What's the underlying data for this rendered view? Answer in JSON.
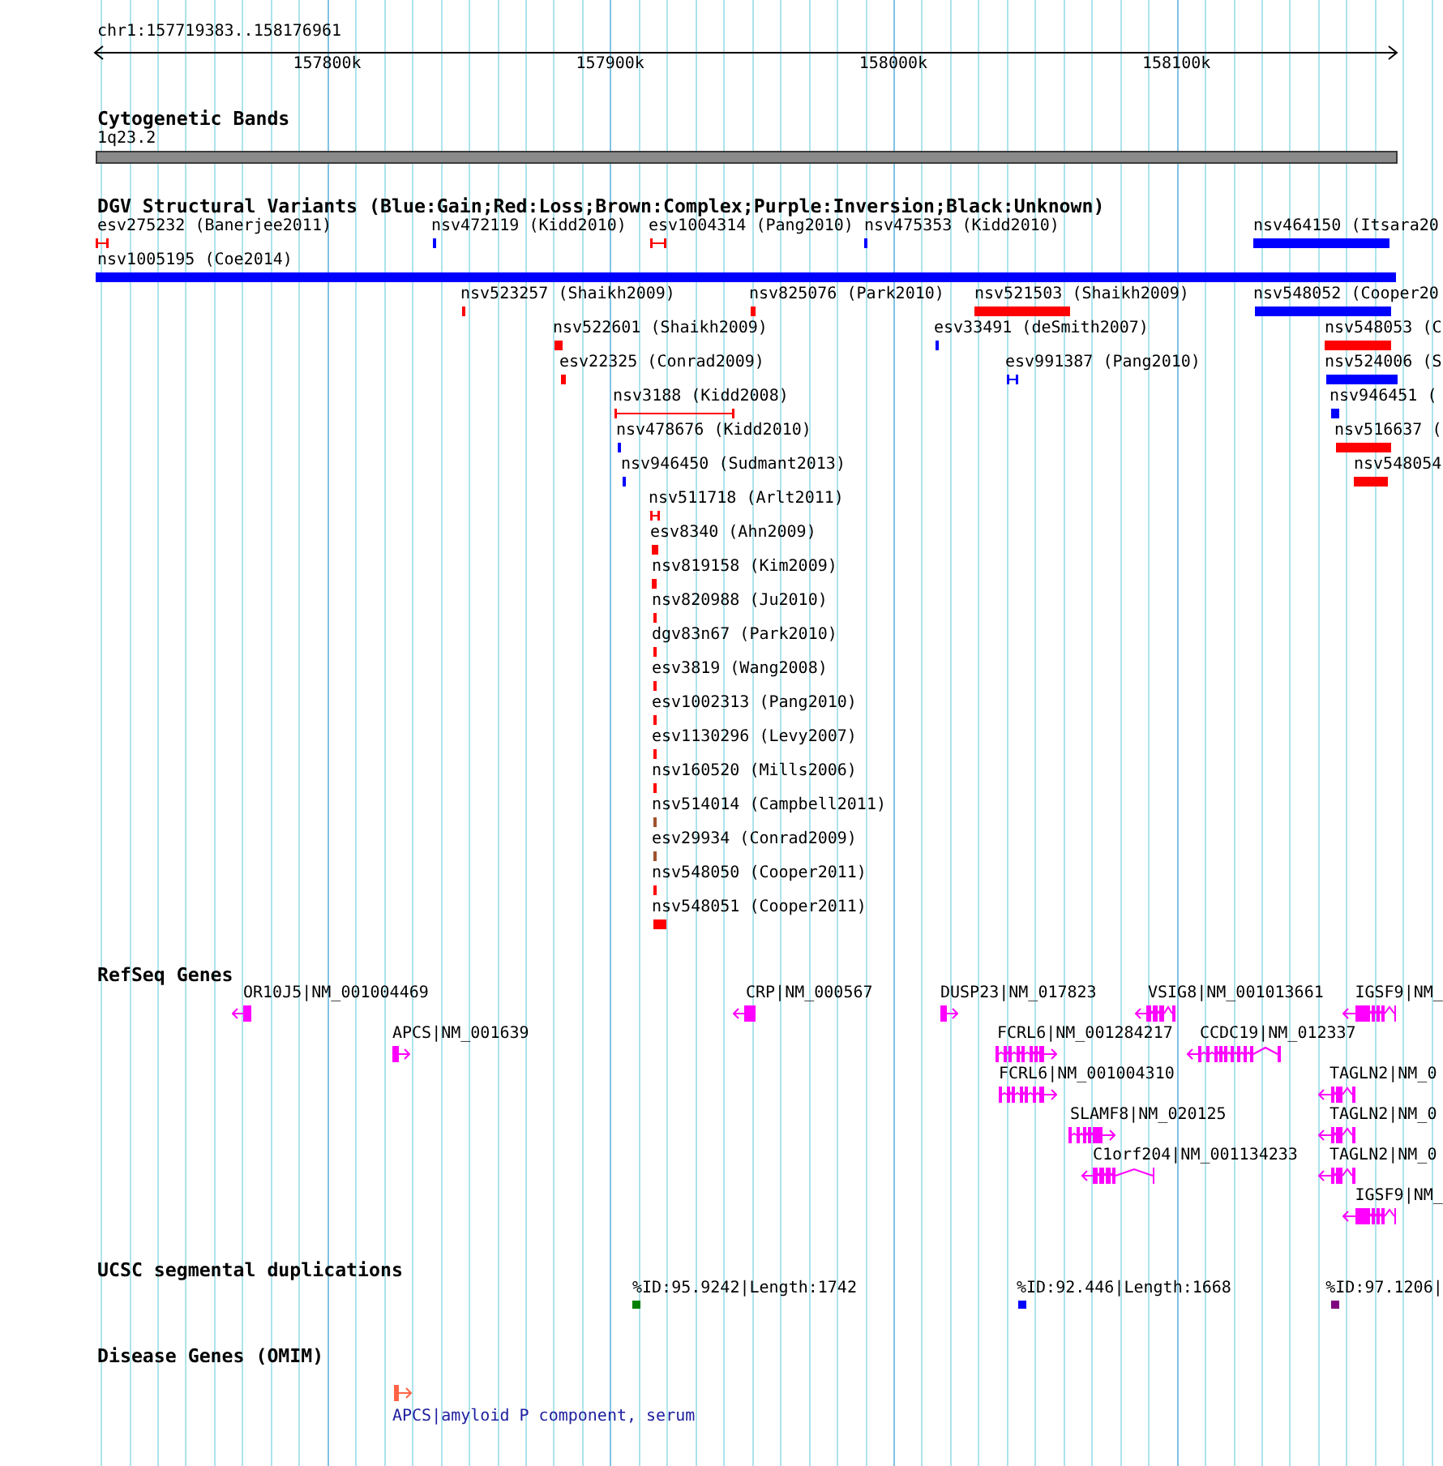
{
  "ruler": {
    "label": "chr1:157719383..158176961",
    "tick_labels": [
      "157800k",
      "157900k",
      "158000k",
      "158100k"
    ]
  },
  "cytogenetic_bands": {
    "title": "Cytogenetic Bands",
    "band": "1q23.2"
  },
  "dgv_variants": {
    "title": "DGV Structural Variants (Blue:Gain;Red:Loss;Brown:Complex;Purple:Inversion;Black:Unknown)",
    "items": [
      {
        "label": "esv275232 (Banerjee2011)",
        "color": "#ff0000",
        "kind": "span"
      },
      {
        "label": "nsv472119 (Kidd2010)",
        "color": "#0000ff",
        "kind": "bar"
      },
      {
        "label": "esv1004314 (Pang2010)",
        "color": "#ff0000",
        "kind": "span"
      },
      {
        "label": "nsv475353 (Kidd2010)",
        "color": "#0000ff",
        "kind": "bar"
      },
      {
        "label": "nsv464150 (Itsara20",
        "color": "#0000ff",
        "kind": "bar"
      },
      {
        "label": "nsv1005195 (Coe2014)",
        "color": "#0000ff",
        "kind": "bar"
      },
      {
        "label": "nsv523257 (Shaikh2009)",
        "color": "#ff0000",
        "kind": "bar"
      },
      {
        "label": "nsv825076 (Park2010)",
        "color": "#ff0000",
        "kind": "bar"
      },
      {
        "label": "nsv521503 (Shaikh2009)",
        "color": "#ff0000",
        "kind": "bar"
      },
      {
        "label": "nsv548052 (Cooper20",
        "color": "#0000ff",
        "kind": "bar"
      },
      {
        "label": "nsv522601 (Shaikh2009)",
        "color": "#ff0000",
        "kind": "bar"
      },
      {
        "label": "esv33491 (deSmith2007)",
        "color": "#0000ff",
        "kind": "bar"
      },
      {
        "label": "nsv548053 (C",
        "color": "#ff0000",
        "kind": "bar"
      },
      {
        "label": "esv22325 (Conrad2009)",
        "color": "#ff0000",
        "kind": "bar"
      },
      {
        "label": "esv991387 (Pang2010)",
        "color": "#0000ff",
        "kind": "span"
      },
      {
        "label": "nsv524006 (S",
        "color": "#0000ff",
        "kind": "bar"
      },
      {
        "label": "nsv3188 (Kidd2008)",
        "color": "#ff0000",
        "kind": "span"
      },
      {
        "label": "nsv946451 (",
        "color": "#0000ff",
        "kind": "bar"
      },
      {
        "label": "nsv478676 (Kidd2010)",
        "color": "#0000ff",
        "kind": "bar"
      },
      {
        "label": "nsv516637 (",
        "color": "#ff0000",
        "kind": "bar"
      },
      {
        "label": "nsv946450 (Sudmant2013)",
        "color": "#0000ff",
        "kind": "bar"
      },
      {
        "label": "nsv548054",
        "color": "#ff0000",
        "kind": "bar"
      },
      {
        "label": "nsv511718 (Arlt2011)",
        "color": "#ff0000",
        "kind": "span"
      },
      {
        "label": "esv8340 (Ahn2009)",
        "color": "#ff0000",
        "kind": "bar"
      },
      {
        "label": "nsv819158 (Kim2009)",
        "color": "#ff0000",
        "kind": "bar"
      },
      {
        "label": "nsv820988 (Ju2010)",
        "color": "#ff0000",
        "kind": "bar"
      },
      {
        "label": "dgv83n67 (Park2010)",
        "color": "#ff0000",
        "kind": "bar"
      },
      {
        "label": "esv3819 (Wang2008)",
        "color": "#ff0000",
        "kind": "bar"
      },
      {
        "label": "esv1002313 (Pang2010)",
        "color": "#ff0000",
        "kind": "bar"
      },
      {
        "label": "esv1130296 (Levy2007)",
        "color": "#ff0000",
        "kind": "bar"
      },
      {
        "label": "nsv160520 (Mills2006)",
        "color": "#ff0000",
        "kind": "bar"
      },
      {
        "label": "nsv514014 (Campbell2011)",
        "color": "#a0522d",
        "kind": "bar"
      },
      {
        "label": "esv29934 (Conrad2009)",
        "color": "#a0522d",
        "kind": "bar"
      },
      {
        "label": "nsv548050 (Cooper2011)",
        "color": "#ff0000",
        "kind": "bar"
      },
      {
        "label": "nsv548051 (Cooper2011)",
        "color": "#ff0000",
        "kind": "bar"
      }
    ]
  },
  "refseq_genes": {
    "title": "RefSeq Genes",
    "items": [
      {
        "label": "OR10J5|NM_001004469",
        "reverse_strand": true
      },
      {
        "label": "CRP|NM_000567",
        "reverse_strand": true
      },
      {
        "label": "DUSP23|NM_017823",
        "reverse_strand": false
      },
      {
        "label": "VSIG8|NM_001013661",
        "reverse_strand": true
      },
      {
        "label": "IGSF9|NM_",
        "reverse_strand": true
      },
      {
        "label": "APCS|NM_001639",
        "reverse_strand": false
      },
      {
        "label": "FCRL6|NM_001284217",
        "reverse_strand": false
      },
      {
        "label": "CCDC19|NM_012337",
        "reverse_strand": true
      },
      {
        "label": "FCRL6|NM_001004310",
        "reverse_strand": false
      },
      {
        "label": "TAGLN2|NM_0",
        "reverse_strand": true
      },
      {
        "label": "SLAMF8|NM_020125",
        "reverse_strand": false
      },
      {
        "label": "TAGLN2|NM_0",
        "reverse_strand": true
      },
      {
        "label": "C1orf204|NM_001134233",
        "reverse_strand": true
      },
      {
        "label": "TAGLN2|NM_0",
        "reverse_strand": true
      },
      {
        "label": "IGSF9|NM_",
        "reverse_strand": true
      }
    ]
  },
  "segmental_duplications": {
    "title": "UCSC segmental duplications",
    "items": [
      {
        "label": "%ID:95.9242|Length:1742",
        "color": "#008000"
      },
      {
        "label": "%ID:92.446|Length:1668",
        "color": "#0000ff"
      },
      {
        "label": "%ID:97.1206|",
        "color": "#800080"
      }
    ]
  },
  "disease_genes": {
    "title": "Disease Genes (OMIM)",
    "items": [
      {
        "label": "APCS|amyloid P component, serum",
        "reverse_strand": false
      }
    ]
  }
}
